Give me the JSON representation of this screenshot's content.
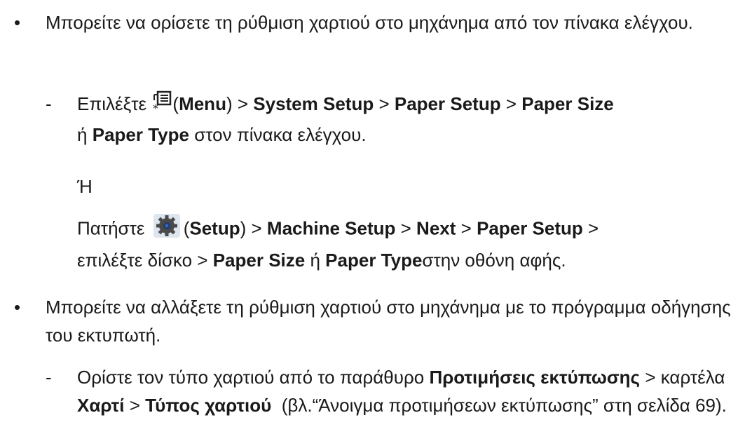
{
  "bullets": [
    {
      "text": "Μπορείτε να ορίσετε τη ρύθμιση χαρτιού στο μηχάνημα από τον πίνακα ελέγχου.",
      "steps": {
        "panel": {
          "prefix": "Επιλέξτε",
          "menu_label": "Menu",
          "path_1": "System Setup",
          "path_2": "Paper Setup",
          "path_3": "Paper Size",
          "or_word": "ή",
          "path_4": "Paper Type",
          "suffix": "στον πίνακα ελέγχου."
        },
        "or_separator": "Ή",
        "touch": {
          "prefix": "Πατήστε",
          "setup_label": "Setup",
          "path_1": "Machine Setup",
          "path_2": "Next",
          "path_3": "Paper Setup",
          "tray_text": "επιλέξτε δίσκο",
          "path_4": "Paper Size",
          "or_word": "ή",
          "path_5": "Paper Type",
          "suffix": "στην οθόνη αφής."
        }
      }
    },
    {
      "text": "Μπορείτε να αλλάξετε τη ρύθμιση χαρτιού στο μηχάνημα με το πρόγραμμα οδήγησης του εκτυπωτή.",
      "step": {
        "prefix": "Ορίστε τον τύπο χαρτιού από το παράθυρο",
        "prefs_label": "Προτιμήσεις εκτύπωσης",
        "tab_word": "καρτέλα",
        "paper_label": "Χαρτί",
        "type_label": "Τύπος χαρτιού",
        "ref_text": "(βλ.“Άνοιγμα προτιμήσεων εκτύπωσης” στη σελίδα 69)."
      }
    }
  ],
  "symbols": {
    "bullet": "•",
    "dash": "-",
    "arrow": ">"
  },
  "icons": [
    "menu-icon",
    "setup-gear-icon"
  ]
}
